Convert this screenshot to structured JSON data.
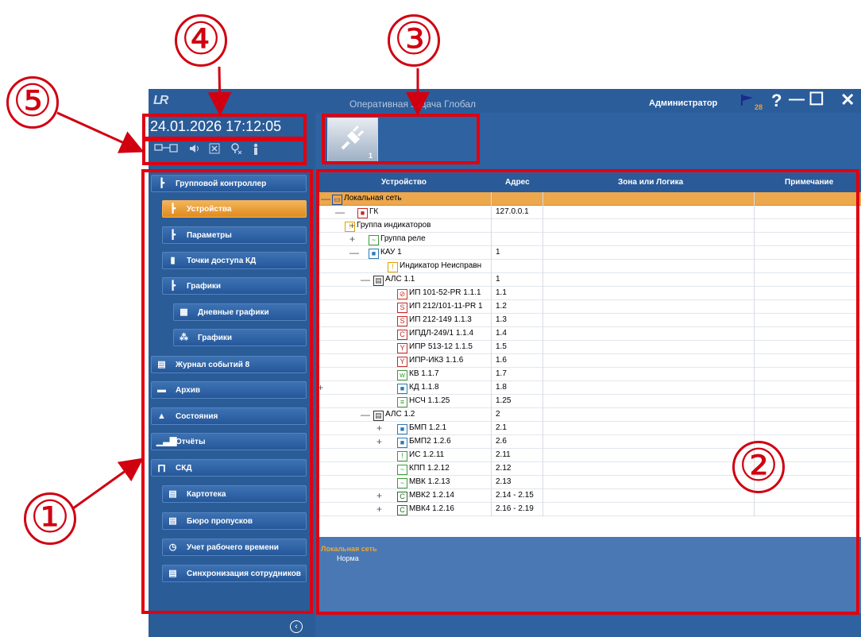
{
  "window": {
    "logo": "LR",
    "title": "Оперативная задача Глобал",
    "user": "Администратор",
    "flag_count": "28",
    "help_icon": "?",
    "minimize_icon": "—",
    "maximize_icon": "☐",
    "close_icon": "✕"
  },
  "datetime": "24.01.2026 17:12:05",
  "status_icons": [
    "network-icon",
    "sound-icon",
    "mute-icon",
    "location-icon",
    "person-icon"
  ],
  "toolbar": {
    "plug_count": "1"
  },
  "nav": [
    {
      "label": "Групповой контроллер",
      "icon": "tree-icon"
    },
    {
      "label": "Устройства",
      "icon": "tree-icon",
      "active": true
    },
    {
      "label": "Параметры",
      "icon": "tree-icon"
    },
    {
      "label": "Точки доступа КД",
      "icon": "door-icon"
    },
    {
      "label": "Графики",
      "icon": "tree-icon"
    },
    {
      "label": "Дневные графики",
      "icon": "calendar-icon"
    },
    {
      "label": "Графики",
      "icon": "schedule-icon"
    },
    {
      "label": "Журнал событий 8",
      "icon": "journal-icon"
    },
    {
      "label": "Архив",
      "icon": "archive-icon"
    },
    {
      "label": "Состояния",
      "icon": "bell-icon"
    },
    {
      "label": "Отчёты",
      "icon": "bars-icon"
    },
    {
      "label": "СКД",
      "icon": "lock-icon"
    },
    {
      "label": "Картотека",
      "icon": "card-icon"
    },
    {
      "label": "Бюро пропусков",
      "icon": "card-icon"
    },
    {
      "label": "Учет рабочего времени",
      "icon": "clock-icon"
    },
    {
      "label": "Синхронизация сотрудников",
      "icon": "card-icon"
    }
  ],
  "table": {
    "headers": [
      "Устройство",
      "Адрес",
      "Зона или Логика",
      "Примечание"
    ],
    "rows": [
      {
        "expander": "—",
        "name": "Локальная сеть",
        "address": "",
        "icon": "network-icon",
        "selected": true
      },
      {
        "expander": "—",
        "name": "ГК",
        "address": "127.0.0.1",
        "icon": "controller-icon"
      },
      {
        "expander": "+",
        "name": "Группа индикаторов",
        "address": "",
        "icon": "indicator-icon"
      },
      {
        "expander": "+",
        "name": "Группа реле",
        "address": "",
        "icon": "relay-icon"
      },
      {
        "expander": "—",
        "name": "КАУ 1",
        "address": "1",
        "icon": "kau-icon"
      },
      {
        "expander": "",
        "name": "Индикатор Неисправн",
        "address": "",
        "icon": "indicator-icon"
      },
      {
        "expander": "—",
        "name": "АЛС 1.1",
        "address": "1",
        "icon": "als-icon"
      },
      {
        "expander": "",
        "name": "ИП 101-52-PR 1.1.1",
        "address": "1.1",
        "icon": "heat-detector-icon"
      },
      {
        "expander": "",
        "name": "ИП 212/101-11-PR 1",
        "address": "1.2",
        "icon": "smoke-detector-icon"
      },
      {
        "expander": "",
        "name": "ИП 212-149 1.1.3",
        "address": "1.3",
        "icon": "smoke-detector-icon"
      },
      {
        "expander": "",
        "name": "ИПДЛ-249/1 1.1.4",
        "address": "1.4",
        "icon": "linear-detector-icon"
      },
      {
        "expander": "",
        "name": "ИПР 513-12 1.1.5",
        "address": "1.5",
        "icon": "manual-callpoint-icon"
      },
      {
        "expander": "",
        "name": "ИПР-ИКЗ 1.1.6",
        "address": "1.6",
        "icon": "manual-callpoint-icon"
      },
      {
        "expander": "",
        "name": "КВ 1.1.7",
        "address": "1.7",
        "icon": "kv-icon"
      },
      {
        "expander": "+",
        "name": "КД 1.1.8",
        "address": "1.8",
        "icon": "kd-icon"
      },
      {
        "expander": "",
        "name": "НСЧ 1.1.25",
        "address": "1.25",
        "icon": "nsch-icon"
      },
      {
        "expander": "—",
        "name": "АЛС 1.2",
        "address": "2",
        "icon": "als-icon"
      },
      {
        "expander": "+",
        "name": "БМП 1.2.1",
        "address": "2.1",
        "icon": "bmp-icon"
      },
      {
        "expander": "+",
        "name": "БМП2 1.2.6",
        "address": "2.6",
        "icon": "bmp-icon"
      },
      {
        "expander": "",
        "name": "ИС 1.2.11",
        "address": "2.11",
        "icon": "siren-icon"
      },
      {
        "expander": "",
        "name": "КПП 1.2.12",
        "address": "2.12",
        "icon": "relay-icon"
      },
      {
        "expander": "",
        "name": "МВК 1.2.13",
        "address": "2.13",
        "icon": "relay-icon"
      },
      {
        "expander": "+",
        "name": "МВК2 1.2.14",
        "address": "2.14 - 2.15",
        "icon": "module-icon"
      },
      {
        "expander": "+",
        "name": "МВК4 1.2.16",
        "address": "2.16 - 2.19",
        "icon": "module-icon"
      }
    ]
  },
  "status": {
    "title": "Локальная сеть",
    "state": "Норма"
  },
  "annotations": [
    "①",
    "②",
    "③",
    "④",
    "⑤"
  ]
}
